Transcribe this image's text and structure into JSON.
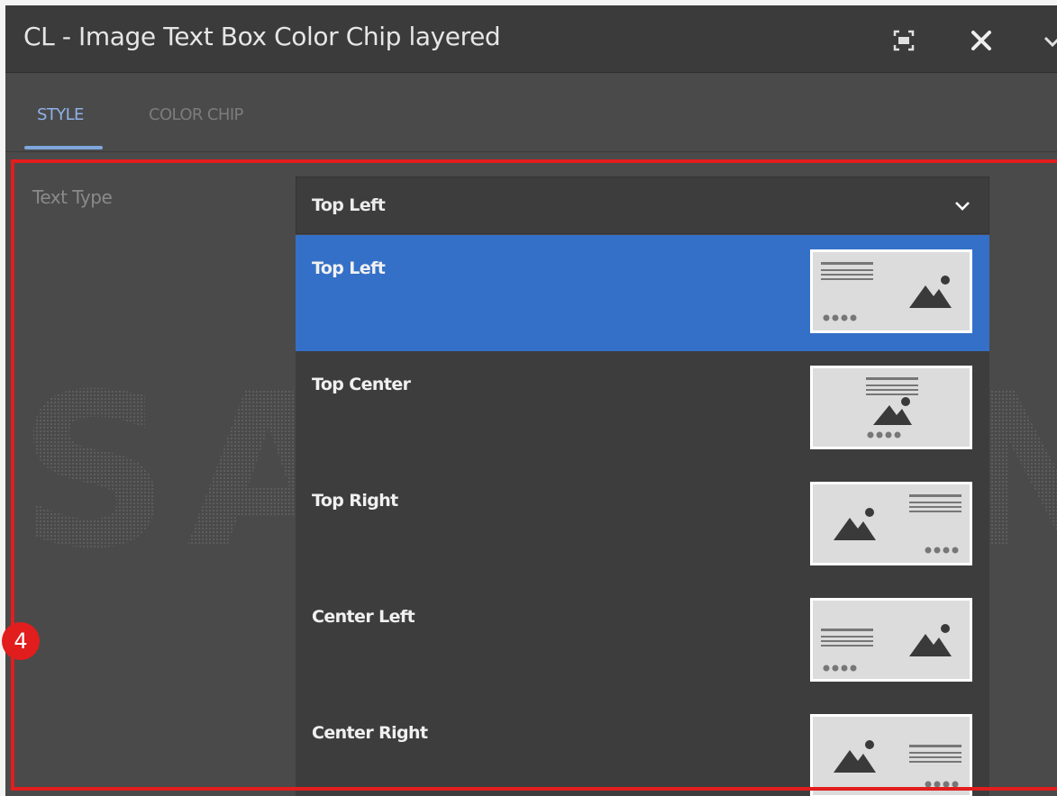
{
  "dialog": {
    "title": "CL - Image Text Box Color Chip layered",
    "buttons": [
      "fullscreen-icon",
      "close-icon",
      "chevron-down-icon"
    ]
  },
  "tabs": [
    {
      "label": "STYLE",
      "active": true
    },
    {
      "label": "COLOR CHIP",
      "active": false
    }
  ],
  "field": {
    "label": "Text Type",
    "selected_value": "Top Left"
  },
  "options": [
    {
      "label": "Top Left",
      "selected": true,
      "thumb": "layout-top-left-icon"
    },
    {
      "label": "Top Center",
      "selected": false,
      "thumb": "layout-top-center-icon"
    },
    {
      "label": "Top Right",
      "selected": false,
      "thumb": "layout-top-right-icon"
    },
    {
      "label": "Center Left",
      "selected": false,
      "thumb": "layout-center-left-icon"
    },
    {
      "label": "Center Right",
      "selected": false,
      "thumb": "layout-center-right-icon"
    }
  ],
  "annotation": {
    "badge": "4",
    "frame_color": "#e21d1d"
  },
  "watermark": {
    "text": "SAMSUNG"
  },
  "colors": {
    "accent": "#3470c7",
    "tab_active": "#8fb2e8",
    "panel": "#4a4a4a"
  }
}
